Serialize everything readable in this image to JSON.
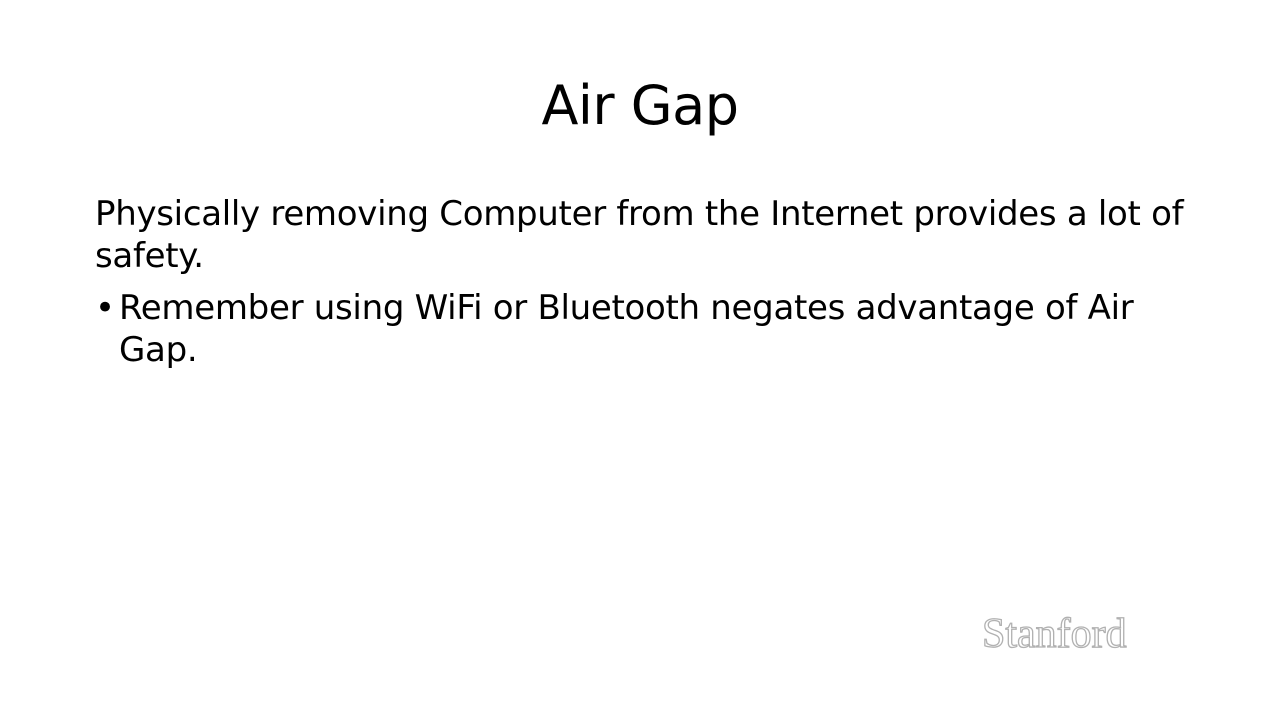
{
  "slide": {
    "title": "Air Gap",
    "paragraph": "Physically removing Computer from the Internet provides a lot of safety.",
    "bullets": [
      "Remember using WiFi or Bluetooth negates advantage of Air Gap."
    ],
    "bullet_glyph": "•",
    "watermark": {
      "text": "Stanford",
      "color": "#b1b1b1"
    }
  }
}
